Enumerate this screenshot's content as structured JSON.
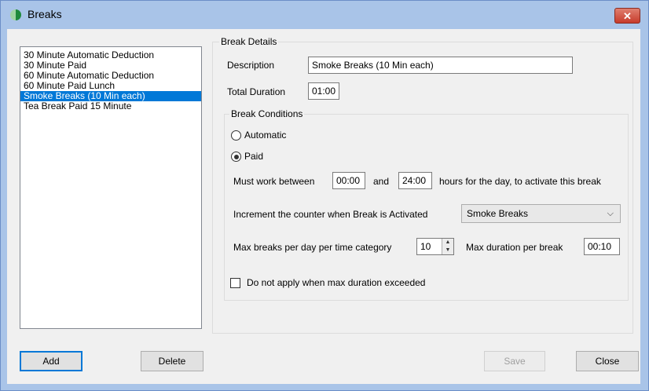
{
  "window": {
    "title": "Breaks",
    "close_glyph": "✕"
  },
  "breaks_list": {
    "items": [
      "30 Minute Automatic Deduction",
      "30 Minute Paid",
      "60 Minute Automatic Deduction",
      "60 Minute Paid Lunch",
      "Smoke Breaks (10 Min each)",
      "Tea Break Paid 15 Minute"
    ],
    "selected_index": 4
  },
  "details": {
    "group_label": "Break Details",
    "description_label": "Description",
    "description_value": "Smoke Breaks (10 Min each)",
    "total_duration_label": "Total Duration",
    "total_duration_value": "01:00"
  },
  "conditions": {
    "group_label": "Break Conditions",
    "automatic_label": "Automatic",
    "automatic_checked": false,
    "paid_label": "Paid",
    "paid_checked": true,
    "must_work_label": "Must work between",
    "from_value": "00:00",
    "and_label": "and",
    "to_value": "24:00",
    "hours_label": "hours for the day, to activate this break",
    "increment_label": "Increment the counter when Break is Activated",
    "increment_value": "Smoke Breaks",
    "max_breaks_label": "Max breaks per day per time category",
    "max_breaks_value": "10",
    "max_duration_label": "Max duration per break",
    "max_duration_value": "00:10",
    "do_not_apply_label": "Do not apply when max duration exceeded",
    "do_not_apply_checked": false
  },
  "buttons": {
    "add": "Add",
    "delete": "Delete",
    "save": "Save",
    "close": "Close"
  }
}
